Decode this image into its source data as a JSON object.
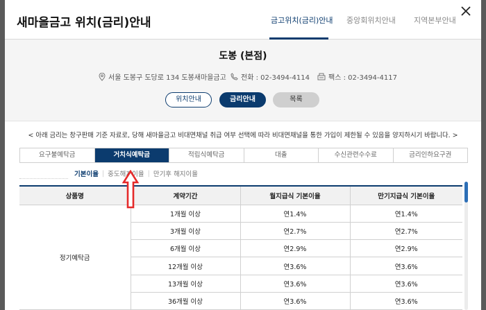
{
  "modal": {
    "title": "새마을금고 위치(금리)안내",
    "nav_tabs": [
      {
        "label": "금고위치(금리)안내",
        "active": true
      },
      {
        "label": "중앙회위치안내",
        "active": false
      },
      {
        "label": "지역본부안내",
        "active": false
      }
    ],
    "close_icon": "close-icon"
  },
  "branch": {
    "name": "도봉 (본점)",
    "address": "서울 도봉구 도당로 134 도봉새마을금고",
    "phone": "전화 : 02-3494-4114",
    "fax": "팩스 : 02-3494-4117"
  },
  "buttons": {
    "location": "위치안내",
    "rates": "금리안내",
    "list": "목록"
  },
  "notice": "< 아래 금리는 창구판매 기준 자료로, 당해 새마을금고 비대면채널 취급 여부 선택에 따라 비대면채널을 통한 가입이 제한될 수 있음을 양지하시기 바랍니다. >",
  "product_tabs": [
    {
      "label": "요구불예탁금",
      "active": false
    },
    {
      "label": "거치식예탁금",
      "active": true
    },
    {
      "label": "적립식예탁금",
      "active": false
    },
    {
      "label": "대출",
      "active": false
    },
    {
      "label": "수신관련수수료",
      "active": false
    },
    {
      "label": "금리인하요구권",
      "active": false
    }
  ],
  "sub_tabs": [
    {
      "label": "기본이율",
      "active": true
    },
    {
      "label": "중도해지이율",
      "active": false
    },
    {
      "label": "만기후 해지이율",
      "active": false
    }
  ],
  "table": {
    "headers": [
      "상품명",
      "계약기간",
      "월지급식 기본이율",
      "만기지급식 기본이율"
    ],
    "product": "정기예탁금",
    "rows": [
      {
        "period": "1개월 이상",
        "monthly": "연1.4%",
        "maturity": "연1.4%"
      },
      {
        "period": "3개월 이상",
        "monthly": "연2.7%",
        "maturity": "연2.7%"
      },
      {
        "period": "6개월 이상",
        "monthly": "연2.9%",
        "maturity": "연2.9%"
      },
      {
        "period": "12개월 이상",
        "monthly": "연3.6%",
        "maturity": "연3.6%"
      },
      {
        "period": "13개월 이상",
        "monthly": "연3.6%",
        "maturity": "연3.6%"
      },
      {
        "period": "36개월 이상",
        "monthly": "연3.6%",
        "maturity": "연3.6%"
      }
    ]
  },
  "colors": {
    "accent": "#0b3b6e",
    "arrow": "#e52a2a",
    "scroll": "#2d6fb7"
  }
}
